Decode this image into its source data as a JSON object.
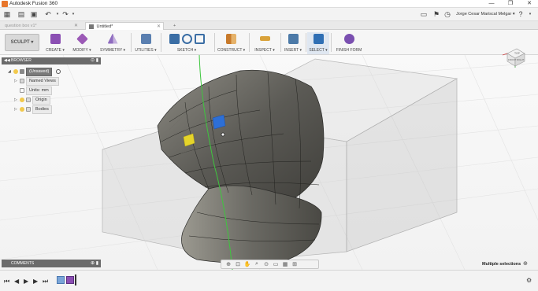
{
  "app": {
    "title": "Autodesk Fusion 360"
  },
  "window_controls": {
    "minimize": "—",
    "restore": "❐",
    "close": "✕"
  },
  "qat": {
    "user_name": "Jorge Cesar Mariscal Melgar ▾"
  },
  "tabs": [
    {
      "label": "question box v1*",
      "state": "inactive"
    },
    {
      "label": "Untitled*",
      "state": "active"
    }
  ],
  "toolbar": {
    "workspace": "SCULPT ▾",
    "groups": [
      {
        "label": "CREATE ▾",
        "icon": "create-form-icon",
        "color": "#8b4fb3"
      },
      {
        "label": "MODIFY ▾",
        "icon": "modify-icon",
        "color": "#9b59b6"
      },
      {
        "label": "SYMMETRY ▾",
        "icon": "symmetry-icon",
        "color": "#8e6bbf"
      },
      {
        "label": "UTILITIES ▾",
        "icon": "utilities-icon",
        "color": "#5a7fb0"
      },
      {
        "label": "SKETCH ▾",
        "icon": "sketch-icon",
        "color": "#3b6ea5"
      },
      {
        "label": "CONSTRUCT ▾",
        "icon": "construct-icon",
        "color": "#c87a2b"
      },
      {
        "label": "INSPECT ▾",
        "icon": "inspect-icon",
        "color": "#d9a23a"
      },
      {
        "label": "INSERT ▾",
        "icon": "insert-icon",
        "color": "#4c7aa8"
      },
      {
        "label": "SELECT ▾",
        "icon": "select-icon",
        "color": "#2f6fb4"
      },
      {
        "label": "FINISH FORM",
        "icon": "finish-form-icon",
        "color": "#7a4fb0"
      }
    ]
  },
  "browser": {
    "title": "BROWSER",
    "nodes": [
      {
        "label": "(Unsaved)",
        "icon": "document-icon"
      },
      {
        "label": "Named Views",
        "icon": "folder-icon"
      },
      {
        "label": "Units: mm",
        "icon": "units-icon"
      },
      {
        "label": "Origin",
        "icon": "folder-icon"
      },
      {
        "label": "Bodies",
        "icon": "folder-icon"
      }
    ]
  },
  "comments": {
    "title": "COMMENTS"
  },
  "status": {
    "text": "Multiple selections"
  },
  "viewcube": {
    "face_top": "TOP",
    "face_front": "FRONT",
    "face_right": "RIGHT"
  },
  "colors": {
    "accent": "#2f6fb4",
    "selected_face_blue": "#2d6fd6",
    "selected_face_yellow": "#e5d42a",
    "sketch_line": "#3ec63e",
    "body_dark": "#5b5a55"
  }
}
